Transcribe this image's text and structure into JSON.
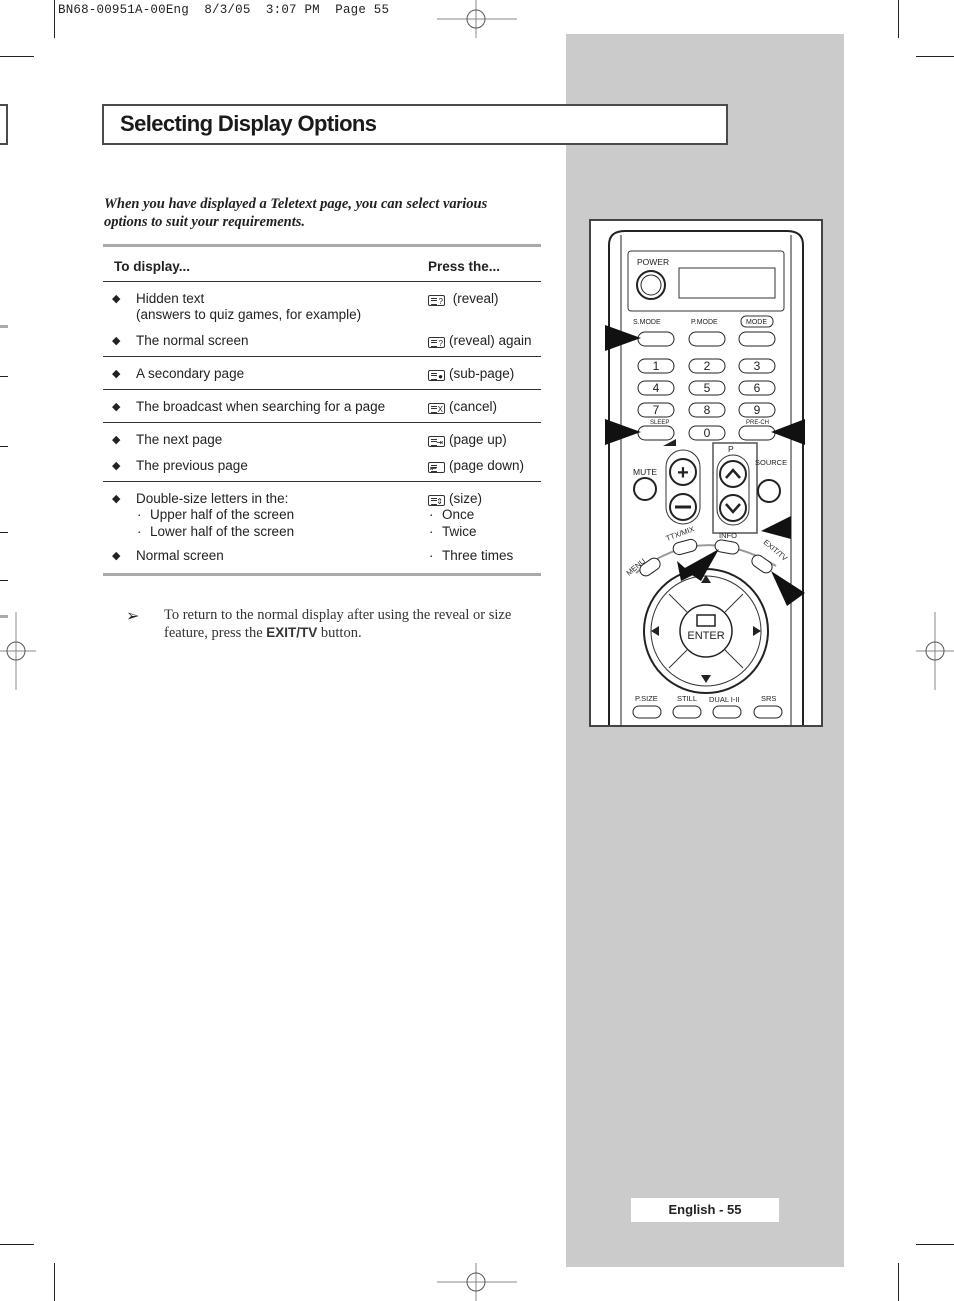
{
  "slug": "BN68-00951A-00Eng  8/3/05  3:07 PM  Page 55",
  "title": "Selecting Display Options",
  "intro": "When you have displayed a Teletext page, you can select various options to suit your requirements.",
  "table": {
    "header": {
      "col1": "To display...",
      "col2": "Press the..."
    },
    "groups": [
      {
        "rows": [
          {
            "text": "Hidden text",
            "subtext": "(answers to quiz games, for example)",
            "icon": "teletext-reveal-icon",
            "press": "(reveal)"
          },
          {
            "text": "The normal screen",
            "icon": "teletext-reveal-icon",
            "press": "(reveal) again"
          }
        ]
      },
      {
        "rows": [
          {
            "text": "A secondary page",
            "icon": "teletext-subpage-icon",
            "press": "(sub-page)"
          }
        ]
      },
      {
        "rows": [
          {
            "text": "The broadcast when searching for a page",
            "icon": "teletext-cancel-icon",
            "press": "(cancel)"
          }
        ]
      },
      {
        "rows": [
          {
            "text": "The next page",
            "icon": "teletext-page-up-icon",
            "press": "(page up)"
          },
          {
            "text": "The previous page",
            "icon": "teletext-page-down-icon",
            "press": "(page down)"
          }
        ]
      },
      {
        "rows": [
          {
            "text": "Double-size letters in the:",
            "icon": "teletext-size-icon",
            "press": "(size)",
            "subitems": [
              {
                "text": "Upper half of the screen",
                "press": "Once"
              },
              {
                "text": "Lower half of the screen",
                "press": "Twice"
              }
            ]
          },
          {
            "text": "Normal screen",
            "press_bullet": "Three times"
          }
        ]
      }
    ]
  },
  "note": {
    "arrow": "➢",
    "before": "To return to the normal display after using the reveal or size feature, press the ",
    "bold": "EXIT/TV",
    "after": " button."
  },
  "remote": {
    "labels": {
      "power": "POWER",
      "smode": "S.MODE",
      "pmode": "P.MODE",
      "mode": "MODE",
      "sleep": "SLEEP",
      "prech": "PRE-CH",
      "mute": "MUTE",
      "p": "P",
      "source": "SOURCE",
      "menu": "MENU",
      "ttxmix": "TTX/MIX",
      "info": "INFO",
      "exittv": "EXIT/TV",
      "enter": "ENTER",
      "psize": "P.SIZE",
      "still": "STILL",
      "dual": "DUAL I-II",
      "srs": "SRS"
    },
    "digits": [
      "1",
      "2",
      "3",
      "4",
      "5",
      "6",
      "7",
      "8",
      "9",
      "0"
    ]
  },
  "footer": {
    "page_label": "English - 55"
  }
}
